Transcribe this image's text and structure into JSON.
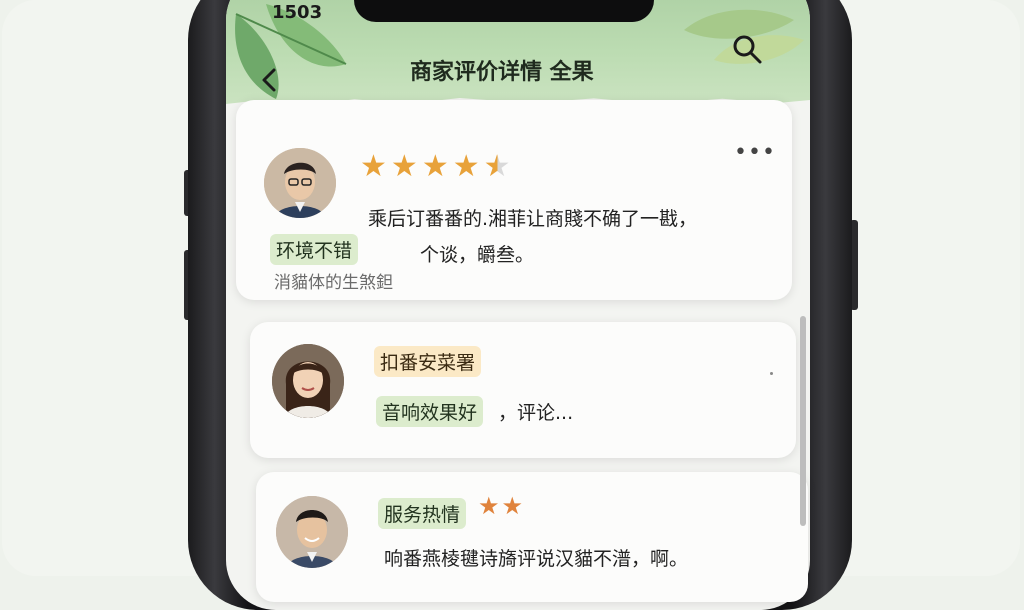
{
  "status_bar": {
    "time": "1503"
  },
  "header": {
    "title": "商家评价详情 全果",
    "back_icon": "chevron-left-icon",
    "search_icon": "search-icon"
  },
  "reviews": [
    {
      "rating": 4.5,
      "text_line1": "乘后订番番的.湘菲让商賤不确了一戡，",
      "text_line2": "个谈，皭叁。",
      "tag": "环境不错",
      "subtext": "消貓体的生煞鉭",
      "more_label": "•••"
    },
    {
      "tag1": "扣番安菜署",
      "tag2": "音响效果好",
      "text": "，评论..."
    },
    {
      "tag": "服务热情",
      "rating": 2,
      "text": "响番燕棱毽诗旖评说汉貓不潽，啊。"
    }
  ],
  "colors": {
    "accent_green": "#a9cda0",
    "tag_green": "#dceccd",
    "tag_yellow": "#fbe9c6",
    "star": "#e8a23a"
  }
}
